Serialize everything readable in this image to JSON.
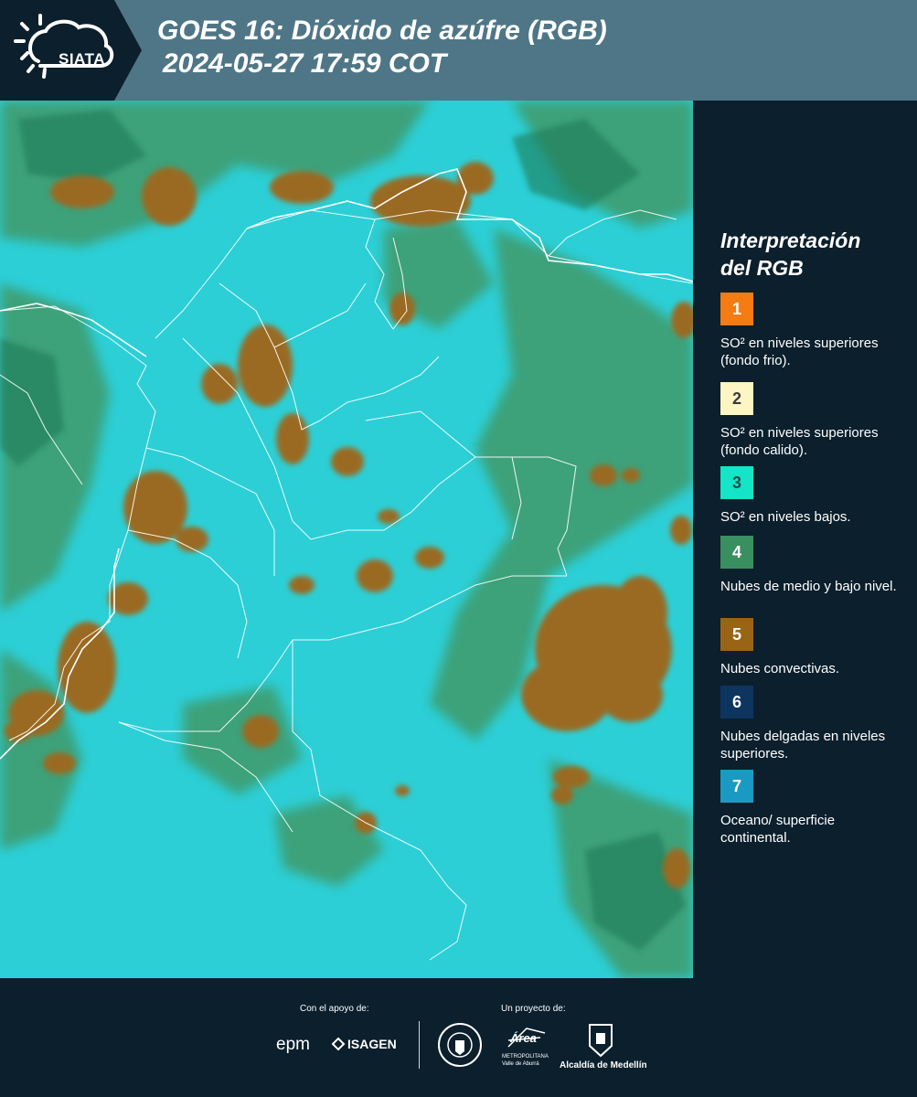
{
  "header": {
    "logo_text": "SIATA",
    "title_line1": "GOES 16: Dióxido de azúfre (RGB)",
    "title_line2": "2024-05-27 17:59 COT"
  },
  "legend": {
    "title_line1": "Interpretación",
    "title_line2": "del RGB",
    "items": [
      {
        "num": "1",
        "color": "#f57c13",
        "text": "SO² en niveles superiores (fondo frio)."
      },
      {
        "num": "2",
        "color": "#fdf5c4",
        "text": "SO² en niveles superiores (fondo calido)."
      },
      {
        "num": "3",
        "color": "#13e5c6",
        "text": "SO² en niveles bajos."
      },
      {
        "num": "4",
        "color": "#3a8f60",
        "text": "Nubes de medio y bajo nivel."
      },
      {
        "num": "5",
        "color": "#9a6416",
        "text": "Nubes convectivas."
      },
      {
        "num": "6",
        "color": "#0e3560",
        "text": "Nubes delgadas en niveles superiores."
      },
      {
        "num": "7",
        "color": "#1a9ac2",
        "text": "Oceano/ superficie continental."
      }
    ]
  },
  "footer": {
    "support_label": "Con el apoyo de:",
    "project_label": "Un proyecto de:",
    "logo_epm": "epm",
    "logo_isagen": "ISAGEN",
    "logo_area": "Área",
    "logo_area_sub": "METROPOLITANA Valle de Aburrá",
    "logo_alcaldia": "Alcaldía de Medellín"
  }
}
